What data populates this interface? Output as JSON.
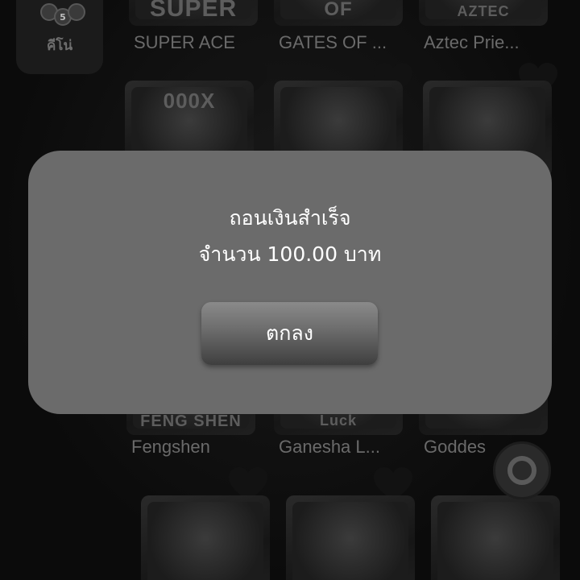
{
  "sidebar": {
    "category_label": "คีโน่",
    "balls": [
      "5"
    ]
  },
  "games": [
    {
      "name": "SUPER ACE",
      "art_text": "SUPER"
    },
    {
      "name": "GATES OF ...",
      "art_text": "OF"
    },
    {
      "name": "Aztec Prie...",
      "art_text": "AZTEC"
    },
    {
      "name": "",
      "art_text": "000X"
    },
    {
      "name": "",
      "art_text": ""
    },
    {
      "name": "",
      "art_text": ""
    },
    {
      "name": "Fengshen",
      "art_text": "FENG SHEN"
    },
    {
      "name": "Ganesha L...",
      "art_text": "Luck"
    },
    {
      "name": "Goddes",
      "art_text": ""
    },
    {
      "name": "",
      "art_text": ""
    },
    {
      "name": "",
      "art_text": ""
    },
    {
      "name": "",
      "art_text": ""
    }
  ],
  "dialog": {
    "title": "ถอนเงินสำเร็จ",
    "message": "จำนวน 100.00 บาท",
    "ok_label": "ตกลง"
  },
  "colors": {
    "overlay_dialog": "#6b6b6b",
    "button_top": "#8a8a8a",
    "button_bottom": "#3f3f3f",
    "text": "#ffffff"
  },
  "icons": {
    "favorite": "heart-icon",
    "floating": "support-icon"
  }
}
